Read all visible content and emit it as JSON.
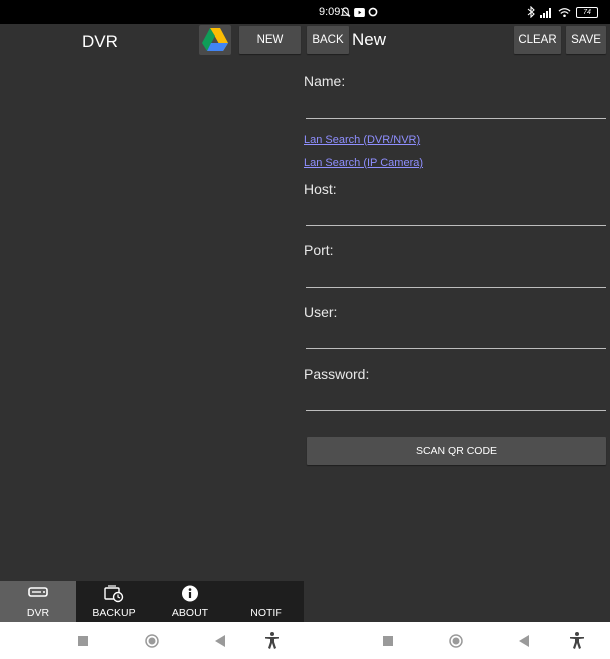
{
  "status_bar": {
    "time": "9:09",
    "battery": "74"
  },
  "left": {
    "title": "DVR",
    "new_label": "NEW",
    "nav": [
      {
        "label": "DVR",
        "icon": "dvr-icon"
      },
      {
        "label": "BACKUP",
        "icon": "backup-icon"
      },
      {
        "label": "ABOUT",
        "icon": "info-icon"
      },
      {
        "label": "NOTIF",
        "icon": ""
      }
    ]
  },
  "right": {
    "back_label": "BACK",
    "title": "New",
    "clear_label": "CLEAR",
    "save_label": "SAVE",
    "name_label": "Name:",
    "lan_dvr": "Lan Search (DVR/NVR)",
    "lan_ip": "Lan Search (IP Camera)",
    "host_label": "Host:",
    "port_label": "Port:",
    "user_label": "User:",
    "password_label": "Password:",
    "scan_label": "SCAN QR CODE"
  },
  "colors": {
    "background": "#313131",
    "button": "#4b4b4b",
    "link": "#8f8fff",
    "nav_bg": "#1e1e1e",
    "nav_active": "#5f5f5f"
  }
}
